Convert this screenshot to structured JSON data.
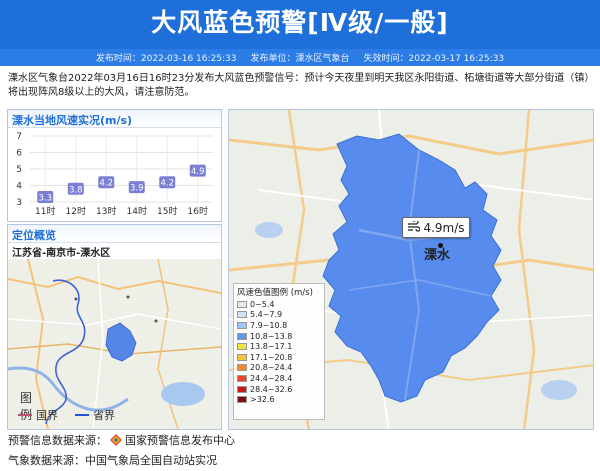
{
  "header": {
    "title": "大风蓝色预警[Ⅳ级/一般]",
    "publish_time": "发布时间：2022-03-16 16:25:33",
    "publisher": "发布单位：溧水区气象台",
    "expire_time": "失效时间：2022-03-17 16:25:33"
  },
  "description": "溧水区气象台2022年03月16日16时23分发布大风蓝色预警信号：预计今天夜里到明天我区永阳街道、柘塘街道等大部分街道（镇）将出现阵风8级以上的大风，请注意防范。",
  "wind_panel": {
    "title": "溧水当地风速实况(m/s)"
  },
  "chart_data": {
    "type": "line",
    "title": "溧水当地风速实况(m/s)",
    "categories": [
      "11时",
      "12时",
      "13时",
      "14时",
      "15时",
      "16时"
    ],
    "values": [
      3.3,
      3.8,
      4.2,
      3.9,
      4.2,
      4.9
    ],
    "yticks": [
      3,
      4,
      5,
      6,
      7
    ],
    "ylim": [
      3,
      7
    ],
    "grid": true,
    "point_color": "#7b7fd4"
  },
  "location_panel": {
    "title": "定位概览",
    "region": "江苏省-南京市-溧水区",
    "legend_title": "图例",
    "legend_items": [
      {
        "label": "国界",
        "color": "#c0506e"
      },
      {
        "label": "省界",
        "color": "#2255d9"
      }
    ]
  },
  "main_map": {
    "wind_value": "4.9m/s",
    "city": "溧水",
    "legend_title": "风速色值图例 (m/s)",
    "legend": [
      {
        "label": "0~5.4",
        "color": "#e8e8e8"
      },
      {
        "label": "5.4~7.9",
        "color": "#cfe3f7"
      },
      {
        "label": "7.9~10.8",
        "color": "#9ec6f3"
      },
      {
        "label": "10.8~13.8",
        "color": "#5c96f0"
      },
      {
        "label": "13.8~17.1",
        "color": "#f5e042"
      },
      {
        "label": "17.1~20.8",
        "color": "#f5c43a"
      },
      {
        "label": "20.8~24.4",
        "color": "#f08a2a"
      },
      {
        "label": "24.4~28.4",
        "color": "#e8452a"
      },
      {
        "label": "28.4~32.6",
        "color": "#c01a1a"
      },
      {
        "label": ">32.6",
        "color": "#800d0d"
      }
    ]
  },
  "footer": {
    "warning_source": "预警信息数据来源：",
    "warning_source_name": "国家预警信息发布中心",
    "weather_source": "气象数据来源：中国气象局全国自动站实况"
  }
}
